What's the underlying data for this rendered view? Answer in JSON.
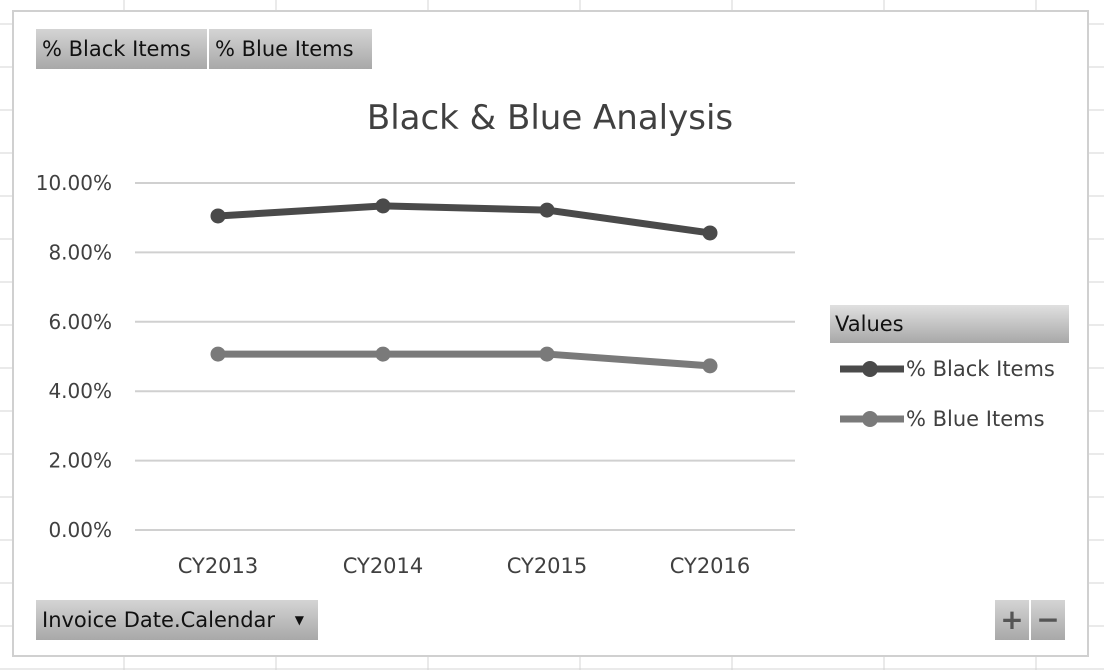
{
  "field_buttons": {
    "values": [
      "% Black Items",
      "% Blue Items"
    ],
    "axis_field": "Invoice Date.Calendar",
    "axis_dropdown_icon": "dropdown-arrow-icon"
  },
  "zoom_buttons": {
    "expand": "+",
    "collapse": "−"
  },
  "legend": {
    "title": "Values"
  },
  "chart_data": {
    "type": "line",
    "title": "Black & Blue Analysis",
    "categories": [
      "CY2013",
      "CY2014",
      "CY2015",
      "CY2016"
    ],
    "ylim": [
      0,
      10
    ],
    "yticks": [
      "0.00%",
      "2.00%",
      "4.00%",
      "6.00%",
      "8.00%",
      "10.00%"
    ],
    "ytick_values": [
      0,
      2,
      4,
      6,
      8,
      10
    ],
    "grid": true,
    "legend_placement": "right",
    "series": [
      {
        "name": "% Black Items",
        "values": [
          9.05,
          9.34,
          9.22,
          8.56
        ],
        "color": "#4a4a4a"
      },
      {
        "name": "% Blue Items",
        "values": [
          5.07,
          5.07,
          5.07,
          4.73
        ],
        "color": "#7a7a7a"
      }
    ]
  }
}
